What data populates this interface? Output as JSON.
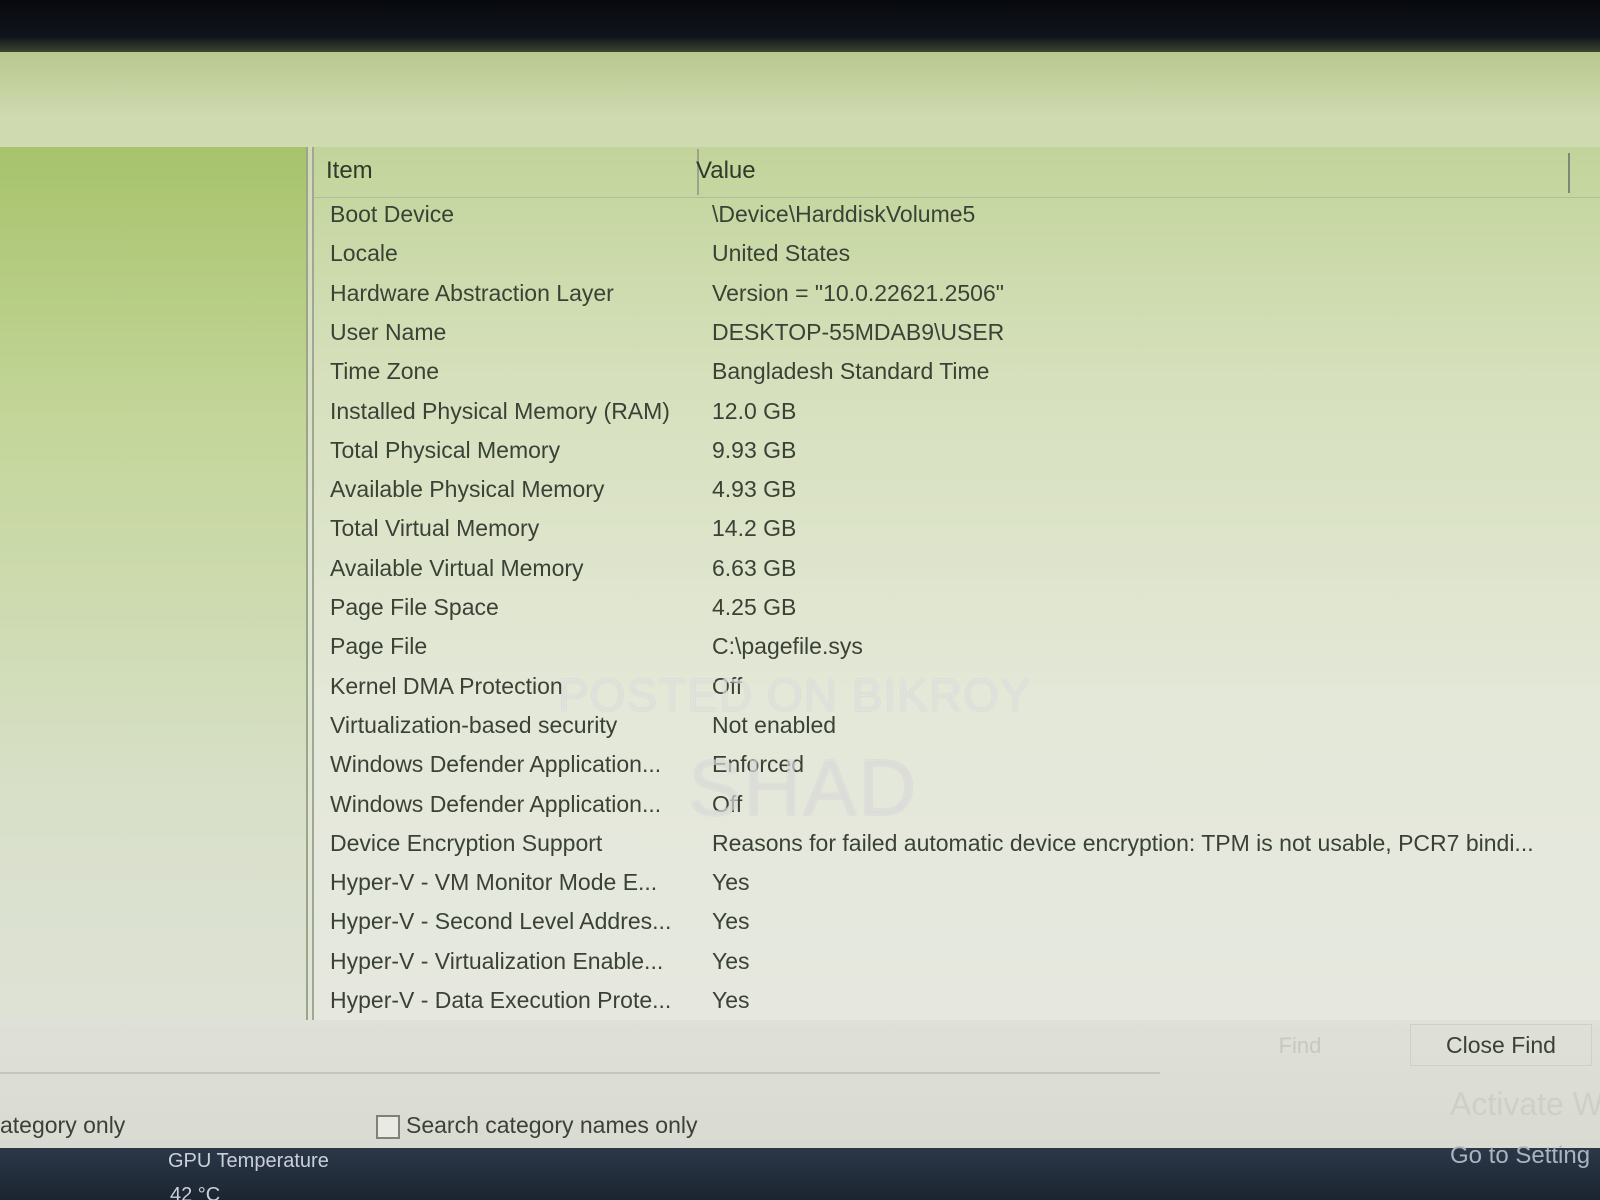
{
  "list": {
    "columns": {
      "item": "Item",
      "value": "Value"
    },
    "rows": [
      {
        "item": "Boot Device",
        "value": "\\Device\\HarddiskVolume5"
      },
      {
        "item": "Locale",
        "value": "United States"
      },
      {
        "item": "Hardware Abstraction Layer",
        "value": "Version = \"10.0.22621.2506\""
      },
      {
        "item": "User Name",
        "value": "DESKTOP-55MDAB9\\USER"
      },
      {
        "item": "Time Zone",
        "value": "Bangladesh Standard Time"
      },
      {
        "item": "Installed Physical Memory (RAM)",
        "value": "12.0 GB"
      },
      {
        "item": "Total Physical Memory",
        "value": "9.93 GB"
      },
      {
        "item": "Available Physical Memory",
        "value": "4.93 GB"
      },
      {
        "item": "Total Virtual Memory",
        "value": "14.2 GB"
      },
      {
        "item": "Available Virtual Memory",
        "value": "6.63 GB"
      },
      {
        "item": "Page File Space",
        "value": "4.25 GB"
      },
      {
        "item": "Page File",
        "value": "C:\\pagefile.sys"
      },
      {
        "item": "Kernel DMA Protection",
        "value": "Off"
      },
      {
        "item": "Virtualization-based security",
        "value": "Not enabled"
      },
      {
        "item": "Windows Defender Application...",
        "value": "Enforced"
      },
      {
        "item": "Windows Defender Application...",
        "value": "Off"
      },
      {
        "item": "Device Encryption Support",
        "value": "Reasons for failed automatic device encryption: TPM is not usable, PCR7 bindi..."
      },
      {
        "item": "Hyper-V - VM Monitor Mode E...",
        "value": "Yes"
      },
      {
        "item": "Hyper-V - Second Level Addres...",
        "value": "Yes"
      },
      {
        "item": "Hyper-V - Virtualization Enable...",
        "value": "Yes"
      },
      {
        "item": "Hyper-V - Data Execution Prote...",
        "value": "Yes"
      }
    ]
  },
  "find_bar": {
    "find_label": "Find",
    "close_find_label": "Close Find",
    "search_selected_category_label": "ategory only",
    "search_category_names_label": "Search category names only"
  },
  "taskbar": {
    "gpu_label": "GPU Temperature",
    "gpu_value": "42 °C"
  },
  "activation": {
    "title": "Activate W",
    "subtitle": "Go to Setting"
  },
  "watermarks": {
    "line1": "POSTED ON BIKROY",
    "line2": "SHAD"
  }
}
